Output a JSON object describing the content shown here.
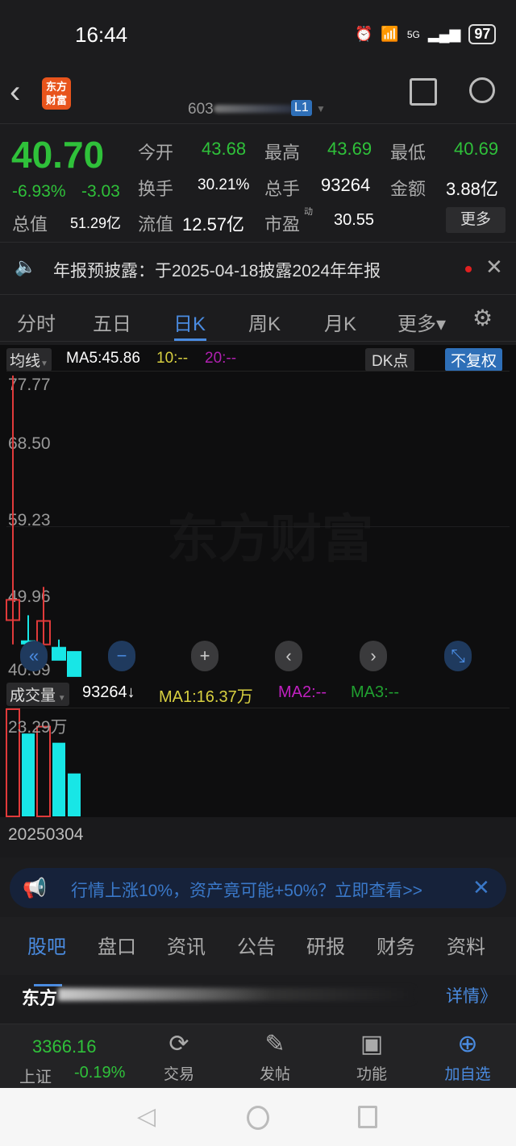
{
  "status_bar": {
    "time": "16:44",
    "network": "5G",
    "battery": "97"
  },
  "header": {
    "logo_text": "东方财富",
    "stock_code_prefix": "603",
    "level_badge": "L1"
  },
  "quote": {
    "price": "40.70",
    "change_pct": "-6.93%",
    "change": "-3.03",
    "fields": [
      {
        "label": "今开",
        "value": "43.68"
      },
      {
        "label": "最高",
        "value": "43.69"
      },
      {
        "label": "最低",
        "value": "40.69"
      },
      {
        "label": "换手",
        "value": "30.21%"
      },
      {
        "label": "总手",
        "value": "93264"
      },
      {
        "label": "金额",
        "value": "3.88亿"
      },
      {
        "label": "总值",
        "value": "51.29亿"
      },
      {
        "label": "流值",
        "value": "12.57亿"
      },
      {
        "label": "市盈",
        "value": "30.55",
        "sup": "动"
      }
    ],
    "more_label": "更多"
  },
  "notice": {
    "text": "年报预披露：于2025-04-18披露2024年年报"
  },
  "chart_tabs": [
    {
      "label": "分时"
    },
    {
      "label": "五日"
    },
    {
      "label": "日K",
      "active": true
    },
    {
      "label": "周K"
    },
    {
      "label": "月K"
    },
    {
      "label": "更多▾"
    }
  ],
  "indicator_bar": {
    "ma_select": "均线",
    "ma5": "MA5:45.86",
    "ma10": "10:--",
    "ma20": "20:--",
    "dk_label": "DK点",
    "adjust_label": "不复权"
  },
  "colors": {
    "up": "#e03a3a",
    "down": "#18e6e6",
    "accent": "#2e6fb8",
    "green": "#2fc13a"
  },
  "watermark": "东方财富",
  "chart_data": [
    {
      "type": "candlestick",
      "y_ticks": [
        "77.77",
        "68.50",
        "59.23",
        "49.96",
        "40.69"
      ],
      "ylim": [
        40.69,
        77.77
      ],
      "candles": [
        {
          "open": 47.6,
          "high": 77.77,
          "low": 44.6,
          "close": 50.1
        },
        {
          "open": 45.0,
          "high": 48.2,
          "low": 44.3,
          "close": 44.8
        },
        {
          "open": 44.6,
          "high": 51.7,
          "low": 44.5,
          "close": 47.5
        },
        {
          "open": 44.2,
          "high": 45.2,
          "low": 43.4,
          "close": 42.7
        },
        {
          "open": 43.68,
          "high": 43.69,
          "low": 40.69,
          "close": 40.7
        }
      ]
    },
    {
      "type": "bar",
      "title": "成交量",
      "value_label": "93264↓",
      "ma1": "MA1:16.37万",
      "ma2": "MA2:--",
      "ma3": "MA3:--",
      "max_label": "23.29万",
      "ylim": [
        0,
        23.29
      ],
      "values": [
        23.29,
        18.0,
        19.5,
        16.0,
        9.33
      ],
      "directions": [
        "up",
        "down",
        "up",
        "down",
        "down"
      ],
      "x_label": "20250304"
    }
  ],
  "banner": {
    "text": "行情上涨10%，资产竟可能+50%？立即查看>>"
  },
  "info_tabs": [
    {
      "label": "股吧",
      "active": true
    },
    {
      "label": "盘口"
    },
    {
      "label": "资讯"
    },
    {
      "label": "公告"
    },
    {
      "label": "研报"
    },
    {
      "label": "财务"
    },
    {
      "label": "资料"
    }
  ],
  "forum": {
    "title_prefix": "东方",
    "detail_link": "详情》"
  },
  "bottom_bar": {
    "index_value": "3366.16",
    "index_name": "上证",
    "index_change": "-0.19%",
    "items": [
      {
        "label": "交易",
        "icon": "yuan-exchange-icon"
      },
      {
        "label": "发帖",
        "icon": "edit-icon"
      },
      {
        "label": "功能",
        "icon": "grid-icon"
      },
      {
        "label": "加自选",
        "icon": "plus-circle-icon"
      }
    ]
  }
}
